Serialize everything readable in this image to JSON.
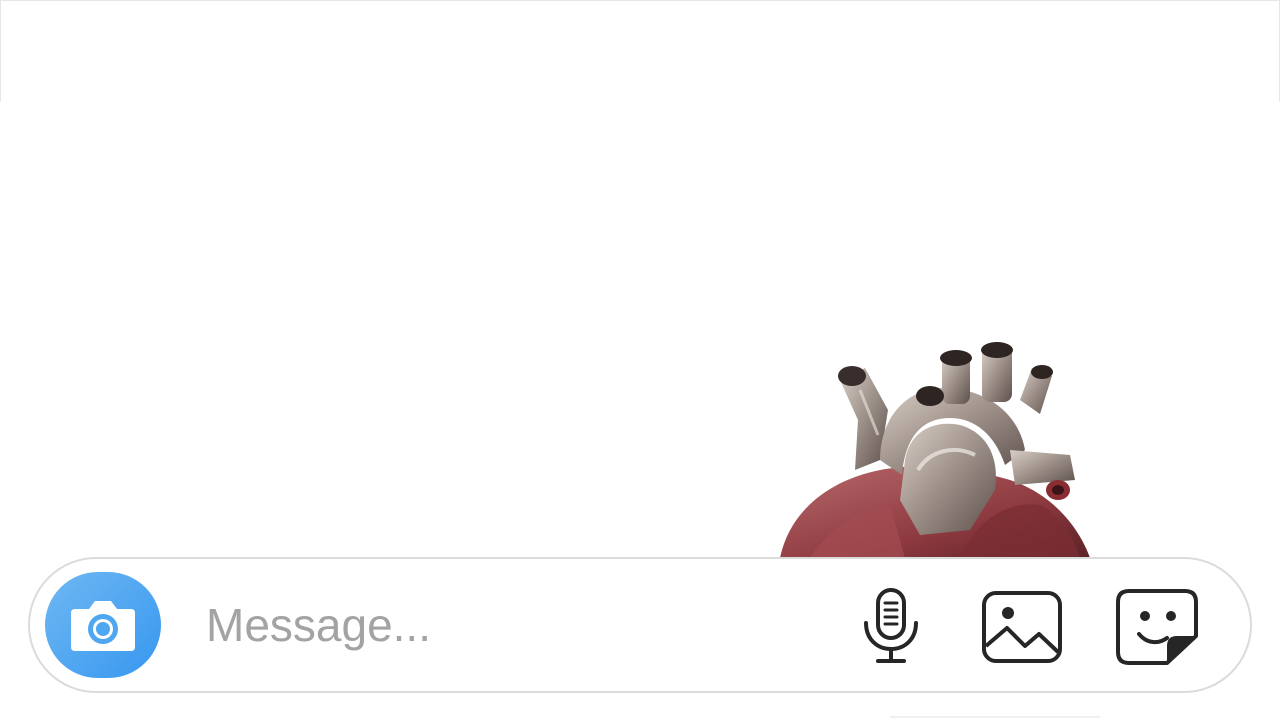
{
  "composer": {
    "placeholder": "Message...",
    "value": ""
  },
  "icons": {
    "camera": "camera-icon",
    "microphone": "microphone-icon",
    "gallery": "gallery-icon",
    "sticker": "sticker-icon"
  },
  "colors": {
    "camera_button_start": "#6fb8f2",
    "camera_button_end": "#3797f0",
    "placeholder_text": "#a3a3a3",
    "composer_border": "#dbdbdb",
    "icon_stroke": "#262626"
  }
}
